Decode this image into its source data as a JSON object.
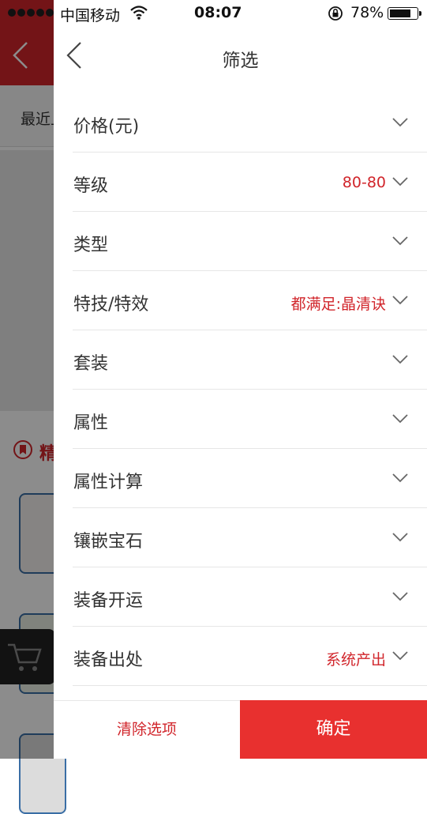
{
  "status_bar": {
    "carrier": "中国移动",
    "time": "08:07",
    "battery_percent": "78%",
    "battery_level": 0.78
  },
  "background": {
    "sort_label": "最近上",
    "section_label": "精"
  },
  "drawer": {
    "title": "筛选",
    "filters": [
      {
        "label": "价格(元)",
        "value": ""
      },
      {
        "label": "等级",
        "value": "80-80"
      },
      {
        "label": "类型",
        "value": ""
      },
      {
        "label": "特技/特效",
        "value": "都满足:晶清诀"
      },
      {
        "label": "套装",
        "value": ""
      },
      {
        "label": "属性",
        "value": ""
      },
      {
        "label": "属性计算",
        "value": ""
      },
      {
        "label": "镶嵌宝石",
        "value": ""
      },
      {
        "label": "装备开运",
        "value": ""
      },
      {
        "label": "装备出处",
        "value": "系统产出"
      }
    ],
    "clear_label": "清除选项",
    "confirm_label": "确定"
  },
  "colors": {
    "accent": "#e8302f",
    "header_red": "#d1252b"
  }
}
